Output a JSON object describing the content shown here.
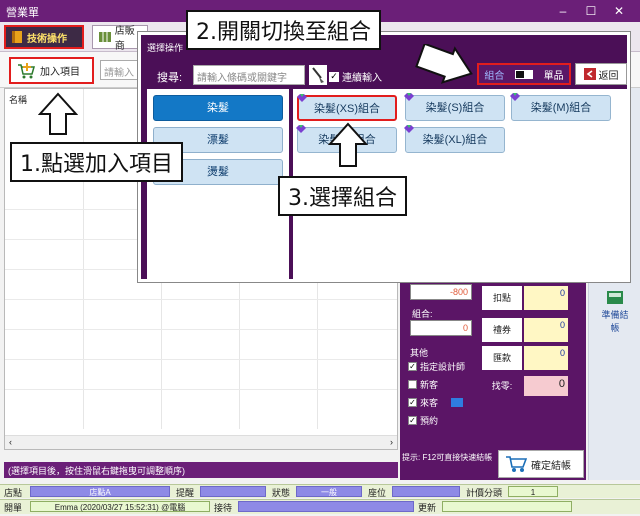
{
  "window": {
    "title": "營業單",
    "controls": [
      "–",
      "☐",
      "✕"
    ]
  },
  "toolbar": {
    "tech_tab": "技術操作",
    "store_tab": "店販商"
  },
  "row2": {
    "add_item": "加入項目",
    "input_placeholder": "請輸入"
  },
  "list": {
    "header": "名稱",
    "scroll_left": "‹",
    "scroll_right": "›"
  },
  "hint": "(選擇項目後，按住滑鼠右鍵拖曳可調整順序)",
  "right_panel": {
    "discount_value": "-800",
    "combo_label": "組合:",
    "combo_value": "0",
    "deduct_label": "扣點",
    "deduct_value": "0",
    "voucher_label": "禮券",
    "voucher_value": "0",
    "remit_label": "匯款",
    "remit_value": "0",
    "change_label": "找零:",
    "change_value": "0",
    "other_label": "其他",
    "checks": [
      {
        "label": "指定設計師",
        "checked": true
      },
      {
        "label": "新客",
        "checked": false
      },
      {
        "label": "來客",
        "checked": true
      },
      {
        "label": "預約",
        "checked": true
      }
    ],
    "f12_hint": "提示: F12可直接快速結帳",
    "checkout": "確定結帳"
  },
  "side": {
    "ready": "準備結帳"
  },
  "status1": {
    "store_label": "店點",
    "store_value": "店點A",
    "remind_label": "提醒",
    "remind_value": "",
    "state_label": "狀態",
    "state_value": "一般",
    "seat_label": "座位",
    "seat_value": "",
    "timer_label": "計價分頭",
    "timer_value": "1"
  },
  "status2": {
    "open_label": "開單",
    "open_value": "Emma (2020/03/27 15:52:31) @電腦",
    "recv_label": "接待",
    "recv_value": "",
    "update_label": "更新",
    "update_value": ""
  },
  "dialog": {
    "title": "選擇操作",
    "search_label": "搜尋:",
    "search_placeholder": "請輸入條碼或關鍵字",
    "continuous": "連續輸入",
    "mode_combo": "組合",
    "mode_single": "單品",
    "back": "返回",
    "categories": [
      "染髮",
      "漂髮",
      "燙髮"
    ],
    "items": [
      "染髮(XS)組合",
      "染髮(S)組合",
      "染髮(M)組合",
      "染髮(L)組合",
      "染髮(XL)組合"
    ]
  },
  "callouts": {
    "step1": "1.點選加入項目",
    "step2": "2.開關切換至組合",
    "step3": "3.選擇組合"
  },
  "colors": {
    "title_bar": "#6b1f78",
    "highlight": "#e21d1d",
    "dialog_bg": "#4b0f57",
    "item_bg": "#cfe3f3",
    "active_cat": "#1378c6"
  }
}
